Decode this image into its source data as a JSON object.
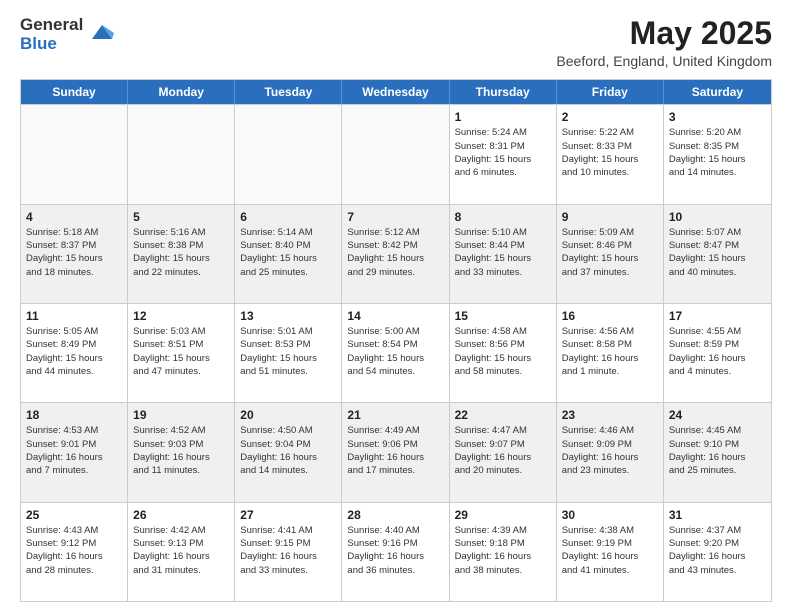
{
  "logo": {
    "general": "General",
    "blue": "Blue"
  },
  "title": "May 2025",
  "subtitle": "Beeford, England, United Kingdom",
  "days": [
    "Sunday",
    "Monday",
    "Tuesday",
    "Wednesday",
    "Thursday",
    "Friday",
    "Saturday"
  ],
  "rows": [
    [
      {
        "day": "",
        "text": "",
        "empty": true
      },
      {
        "day": "",
        "text": "",
        "empty": true
      },
      {
        "day": "",
        "text": "",
        "empty": true
      },
      {
        "day": "",
        "text": "",
        "empty": true
      },
      {
        "day": "1",
        "text": "Sunrise: 5:24 AM\nSunset: 8:31 PM\nDaylight: 15 hours\nand 6 minutes.",
        "empty": false
      },
      {
        "day": "2",
        "text": "Sunrise: 5:22 AM\nSunset: 8:33 PM\nDaylight: 15 hours\nand 10 minutes.",
        "empty": false
      },
      {
        "day": "3",
        "text": "Sunrise: 5:20 AM\nSunset: 8:35 PM\nDaylight: 15 hours\nand 14 minutes.",
        "empty": false
      }
    ],
    [
      {
        "day": "4",
        "text": "Sunrise: 5:18 AM\nSunset: 8:37 PM\nDaylight: 15 hours\nand 18 minutes.",
        "empty": false
      },
      {
        "day": "5",
        "text": "Sunrise: 5:16 AM\nSunset: 8:38 PM\nDaylight: 15 hours\nand 22 minutes.",
        "empty": false
      },
      {
        "day": "6",
        "text": "Sunrise: 5:14 AM\nSunset: 8:40 PM\nDaylight: 15 hours\nand 25 minutes.",
        "empty": false
      },
      {
        "day": "7",
        "text": "Sunrise: 5:12 AM\nSunset: 8:42 PM\nDaylight: 15 hours\nand 29 minutes.",
        "empty": false
      },
      {
        "day": "8",
        "text": "Sunrise: 5:10 AM\nSunset: 8:44 PM\nDaylight: 15 hours\nand 33 minutes.",
        "empty": false
      },
      {
        "day": "9",
        "text": "Sunrise: 5:09 AM\nSunset: 8:46 PM\nDaylight: 15 hours\nand 37 minutes.",
        "empty": false
      },
      {
        "day": "10",
        "text": "Sunrise: 5:07 AM\nSunset: 8:47 PM\nDaylight: 15 hours\nand 40 minutes.",
        "empty": false
      }
    ],
    [
      {
        "day": "11",
        "text": "Sunrise: 5:05 AM\nSunset: 8:49 PM\nDaylight: 15 hours\nand 44 minutes.",
        "empty": false
      },
      {
        "day": "12",
        "text": "Sunrise: 5:03 AM\nSunset: 8:51 PM\nDaylight: 15 hours\nand 47 minutes.",
        "empty": false
      },
      {
        "day": "13",
        "text": "Sunrise: 5:01 AM\nSunset: 8:53 PM\nDaylight: 15 hours\nand 51 minutes.",
        "empty": false
      },
      {
        "day": "14",
        "text": "Sunrise: 5:00 AM\nSunset: 8:54 PM\nDaylight: 15 hours\nand 54 minutes.",
        "empty": false
      },
      {
        "day": "15",
        "text": "Sunrise: 4:58 AM\nSunset: 8:56 PM\nDaylight: 15 hours\nand 58 minutes.",
        "empty": false
      },
      {
        "day": "16",
        "text": "Sunrise: 4:56 AM\nSunset: 8:58 PM\nDaylight: 16 hours\nand 1 minute.",
        "empty": false
      },
      {
        "day": "17",
        "text": "Sunrise: 4:55 AM\nSunset: 8:59 PM\nDaylight: 16 hours\nand 4 minutes.",
        "empty": false
      }
    ],
    [
      {
        "day": "18",
        "text": "Sunrise: 4:53 AM\nSunset: 9:01 PM\nDaylight: 16 hours\nand 7 minutes.",
        "empty": false
      },
      {
        "day": "19",
        "text": "Sunrise: 4:52 AM\nSunset: 9:03 PM\nDaylight: 16 hours\nand 11 minutes.",
        "empty": false
      },
      {
        "day": "20",
        "text": "Sunrise: 4:50 AM\nSunset: 9:04 PM\nDaylight: 16 hours\nand 14 minutes.",
        "empty": false
      },
      {
        "day": "21",
        "text": "Sunrise: 4:49 AM\nSunset: 9:06 PM\nDaylight: 16 hours\nand 17 minutes.",
        "empty": false
      },
      {
        "day": "22",
        "text": "Sunrise: 4:47 AM\nSunset: 9:07 PM\nDaylight: 16 hours\nand 20 minutes.",
        "empty": false
      },
      {
        "day": "23",
        "text": "Sunrise: 4:46 AM\nSunset: 9:09 PM\nDaylight: 16 hours\nand 23 minutes.",
        "empty": false
      },
      {
        "day": "24",
        "text": "Sunrise: 4:45 AM\nSunset: 9:10 PM\nDaylight: 16 hours\nand 25 minutes.",
        "empty": false
      }
    ],
    [
      {
        "day": "25",
        "text": "Sunrise: 4:43 AM\nSunset: 9:12 PM\nDaylight: 16 hours\nand 28 minutes.",
        "empty": false
      },
      {
        "day": "26",
        "text": "Sunrise: 4:42 AM\nSunset: 9:13 PM\nDaylight: 16 hours\nand 31 minutes.",
        "empty": false
      },
      {
        "day": "27",
        "text": "Sunrise: 4:41 AM\nSunset: 9:15 PM\nDaylight: 16 hours\nand 33 minutes.",
        "empty": false
      },
      {
        "day": "28",
        "text": "Sunrise: 4:40 AM\nSunset: 9:16 PM\nDaylight: 16 hours\nand 36 minutes.",
        "empty": false
      },
      {
        "day": "29",
        "text": "Sunrise: 4:39 AM\nSunset: 9:18 PM\nDaylight: 16 hours\nand 38 minutes.",
        "empty": false
      },
      {
        "day": "30",
        "text": "Sunrise: 4:38 AM\nSunset: 9:19 PM\nDaylight: 16 hours\nand 41 minutes.",
        "empty": false
      },
      {
        "day": "31",
        "text": "Sunrise: 4:37 AM\nSunset: 9:20 PM\nDaylight: 16 hours\nand 43 minutes.",
        "empty": false
      }
    ]
  ]
}
